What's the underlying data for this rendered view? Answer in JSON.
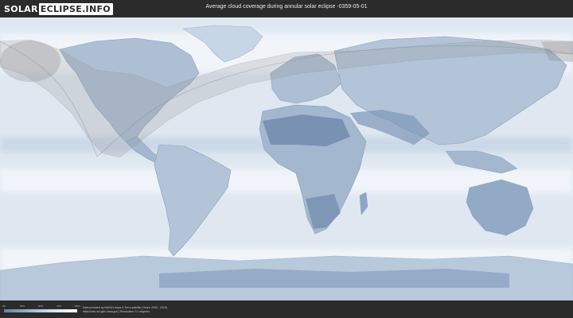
{
  "header": {
    "logo_part1": "SOLAR",
    "logo_part2": "ECLIPSE.INFO",
    "title": "Average cloud coverage during annular solar eclipse -0359-05-01"
  },
  "map": {
    "ocean_color": "#dfe8f1",
    "cloud_light_color": "#f3f6fa",
    "land_color": "#8ea6c4",
    "land_dark_color": "#6b86aa",
    "shadow_color": "#8c8c8c"
  },
  "legend": {
    "ticks": [
      "0%",
      "25%",
      "50%",
      "75%",
      "100%"
    ],
    "gradient": [
      "#5e7fa8",
      "#9ab2cc",
      "#d6e1ec",
      "#ffffff"
    ]
  },
  "footer": {
    "credit_line1": "Data provided by NASA's Aqua & Terra satellite (Years: 2000 - 2019)",
    "credit_line2": "https://neo.sci.gsfc.nasa.gov | Resolution: 0.1 degrees"
  }
}
